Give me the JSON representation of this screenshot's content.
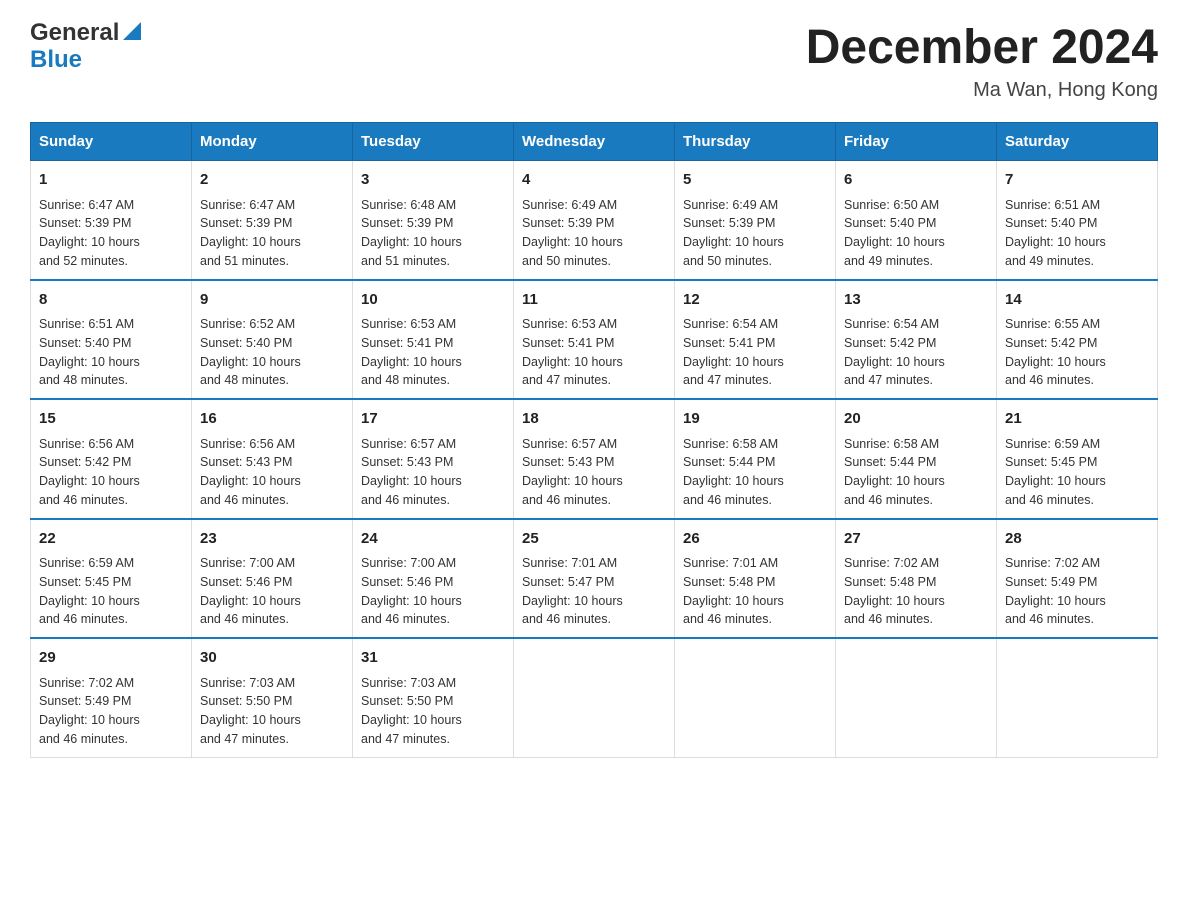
{
  "header": {
    "logo_line1": "General",
    "logo_line2": "Blue",
    "title": "December 2024",
    "location": "Ma Wan, Hong Kong"
  },
  "days_of_week": [
    "Sunday",
    "Monday",
    "Tuesday",
    "Wednesday",
    "Thursday",
    "Friday",
    "Saturday"
  ],
  "weeks": [
    [
      {
        "day": "1",
        "sunrise": "6:47 AM",
        "sunset": "5:39 PM",
        "daylight": "10 hours and 52 minutes."
      },
      {
        "day": "2",
        "sunrise": "6:47 AM",
        "sunset": "5:39 PM",
        "daylight": "10 hours and 51 minutes."
      },
      {
        "day": "3",
        "sunrise": "6:48 AM",
        "sunset": "5:39 PM",
        "daylight": "10 hours and 51 minutes."
      },
      {
        "day": "4",
        "sunrise": "6:49 AM",
        "sunset": "5:39 PM",
        "daylight": "10 hours and 50 minutes."
      },
      {
        "day": "5",
        "sunrise": "6:49 AM",
        "sunset": "5:39 PM",
        "daylight": "10 hours and 50 minutes."
      },
      {
        "day": "6",
        "sunrise": "6:50 AM",
        "sunset": "5:40 PM",
        "daylight": "10 hours and 49 minutes."
      },
      {
        "day": "7",
        "sunrise": "6:51 AM",
        "sunset": "5:40 PM",
        "daylight": "10 hours and 49 minutes."
      }
    ],
    [
      {
        "day": "8",
        "sunrise": "6:51 AM",
        "sunset": "5:40 PM",
        "daylight": "10 hours and 48 minutes."
      },
      {
        "day": "9",
        "sunrise": "6:52 AM",
        "sunset": "5:40 PM",
        "daylight": "10 hours and 48 minutes."
      },
      {
        "day": "10",
        "sunrise": "6:53 AM",
        "sunset": "5:41 PM",
        "daylight": "10 hours and 48 minutes."
      },
      {
        "day": "11",
        "sunrise": "6:53 AM",
        "sunset": "5:41 PM",
        "daylight": "10 hours and 47 minutes."
      },
      {
        "day": "12",
        "sunrise": "6:54 AM",
        "sunset": "5:41 PM",
        "daylight": "10 hours and 47 minutes."
      },
      {
        "day": "13",
        "sunrise": "6:54 AM",
        "sunset": "5:42 PM",
        "daylight": "10 hours and 47 minutes."
      },
      {
        "day": "14",
        "sunrise": "6:55 AM",
        "sunset": "5:42 PM",
        "daylight": "10 hours and 46 minutes."
      }
    ],
    [
      {
        "day": "15",
        "sunrise": "6:56 AM",
        "sunset": "5:42 PM",
        "daylight": "10 hours and 46 minutes."
      },
      {
        "day": "16",
        "sunrise": "6:56 AM",
        "sunset": "5:43 PM",
        "daylight": "10 hours and 46 minutes."
      },
      {
        "day": "17",
        "sunrise": "6:57 AM",
        "sunset": "5:43 PM",
        "daylight": "10 hours and 46 minutes."
      },
      {
        "day": "18",
        "sunrise": "6:57 AM",
        "sunset": "5:43 PM",
        "daylight": "10 hours and 46 minutes."
      },
      {
        "day": "19",
        "sunrise": "6:58 AM",
        "sunset": "5:44 PM",
        "daylight": "10 hours and 46 minutes."
      },
      {
        "day": "20",
        "sunrise": "6:58 AM",
        "sunset": "5:44 PM",
        "daylight": "10 hours and 46 minutes."
      },
      {
        "day": "21",
        "sunrise": "6:59 AM",
        "sunset": "5:45 PM",
        "daylight": "10 hours and 46 minutes."
      }
    ],
    [
      {
        "day": "22",
        "sunrise": "6:59 AM",
        "sunset": "5:45 PM",
        "daylight": "10 hours and 46 minutes."
      },
      {
        "day": "23",
        "sunrise": "7:00 AM",
        "sunset": "5:46 PM",
        "daylight": "10 hours and 46 minutes."
      },
      {
        "day": "24",
        "sunrise": "7:00 AM",
        "sunset": "5:46 PM",
        "daylight": "10 hours and 46 minutes."
      },
      {
        "day": "25",
        "sunrise": "7:01 AM",
        "sunset": "5:47 PM",
        "daylight": "10 hours and 46 minutes."
      },
      {
        "day": "26",
        "sunrise": "7:01 AM",
        "sunset": "5:48 PM",
        "daylight": "10 hours and 46 minutes."
      },
      {
        "day": "27",
        "sunrise": "7:02 AM",
        "sunset": "5:48 PM",
        "daylight": "10 hours and 46 minutes."
      },
      {
        "day": "28",
        "sunrise": "7:02 AM",
        "sunset": "5:49 PM",
        "daylight": "10 hours and 46 minutes."
      }
    ],
    [
      {
        "day": "29",
        "sunrise": "7:02 AM",
        "sunset": "5:49 PM",
        "daylight": "10 hours and 46 minutes."
      },
      {
        "day": "30",
        "sunrise": "7:03 AM",
        "sunset": "5:50 PM",
        "daylight": "10 hours and 47 minutes."
      },
      {
        "day": "31",
        "sunrise": "7:03 AM",
        "sunset": "5:50 PM",
        "daylight": "10 hours and 47 minutes."
      },
      null,
      null,
      null,
      null
    ]
  ],
  "labels": {
    "sunrise": "Sunrise:",
    "sunset": "Sunset:",
    "daylight": "Daylight:"
  },
  "colors": {
    "header_bg": "#1a7abf",
    "logo_blue": "#1a7abf"
  }
}
